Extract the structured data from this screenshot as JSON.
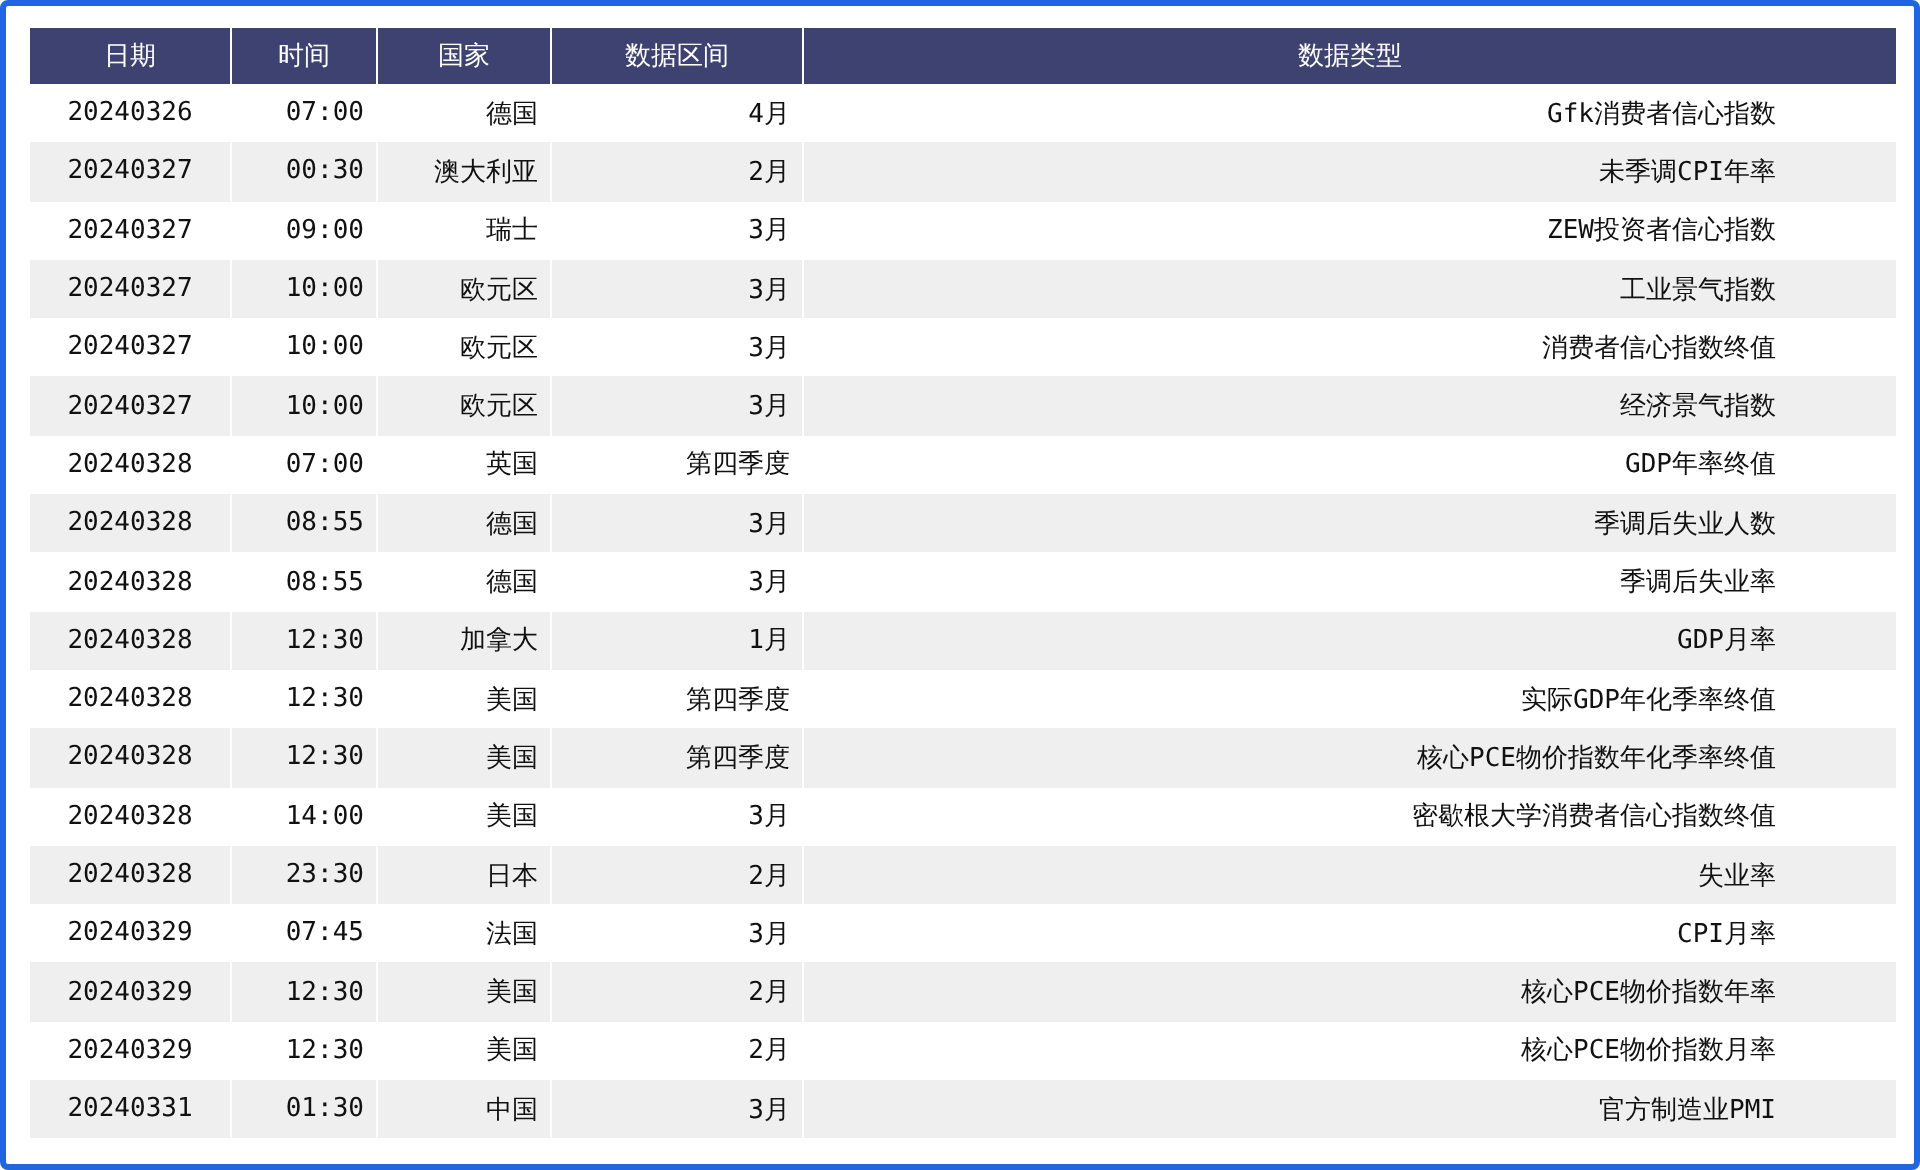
{
  "table": {
    "columns": [
      "日期",
      "时间",
      "国家",
      "数据区间",
      "数据类型"
    ],
    "rows": [
      [
        "20240326",
        "07:00",
        "德国",
        "4月",
        "Gfk消费者信心指数"
      ],
      [
        "20240327",
        "00:30",
        "澳大利亚",
        "2月",
        "未季调CPI年率"
      ],
      [
        "20240327",
        "09:00",
        "瑞士",
        "3月",
        "ZEW投资者信心指数"
      ],
      [
        "20240327",
        "10:00",
        "欧元区",
        "3月",
        "工业景气指数"
      ],
      [
        "20240327",
        "10:00",
        "欧元区",
        "3月",
        "消费者信心指数终值"
      ],
      [
        "20240327",
        "10:00",
        "欧元区",
        "3月",
        "经济景气指数"
      ],
      [
        "20240328",
        "07:00",
        "英国",
        "第四季度",
        "GDP年率终值"
      ],
      [
        "20240328",
        "08:55",
        "德国",
        "3月",
        "季调后失业人数"
      ],
      [
        "20240328",
        "08:55",
        "德国",
        "3月",
        "季调后失业率"
      ],
      [
        "20240328",
        "12:30",
        "加拿大",
        "1月",
        "GDP月率"
      ],
      [
        "20240328",
        "12:30",
        "美国",
        "第四季度",
        "实际GDP年化季率终值"
      ],
      [
        "20240328",
        "12:30",
        "美国",
        "第四季度",
        "核心PCE物价指数年化季率终值"
      ],
      [
        "20240328",
        "14:00",
        "美国",
        "3月",
        "密歇根大学消费者信心指数终值"
      ],
      [
        "20240328",
        "23:30",
        "日本",
        "2月",
        "失业率"
      ],
      [
        "20240329",
        "07:45",
        "法国",
        "3月",
        "CPI月率"
      ],
      [
        "20240329",
        "12:30",
        "美国",
        "2月",
        "核心PCE物价指数年率"
      ],
      [
        "20240329",
        "12:30",
        "美国",
        "2月",
        "核心PCE物价指数月率"
      ],
      [
        "20240331",
        "01:30",
        "中国",
        "3月",
        "官方制造业PMI"
      ]
    ]
  }
}
